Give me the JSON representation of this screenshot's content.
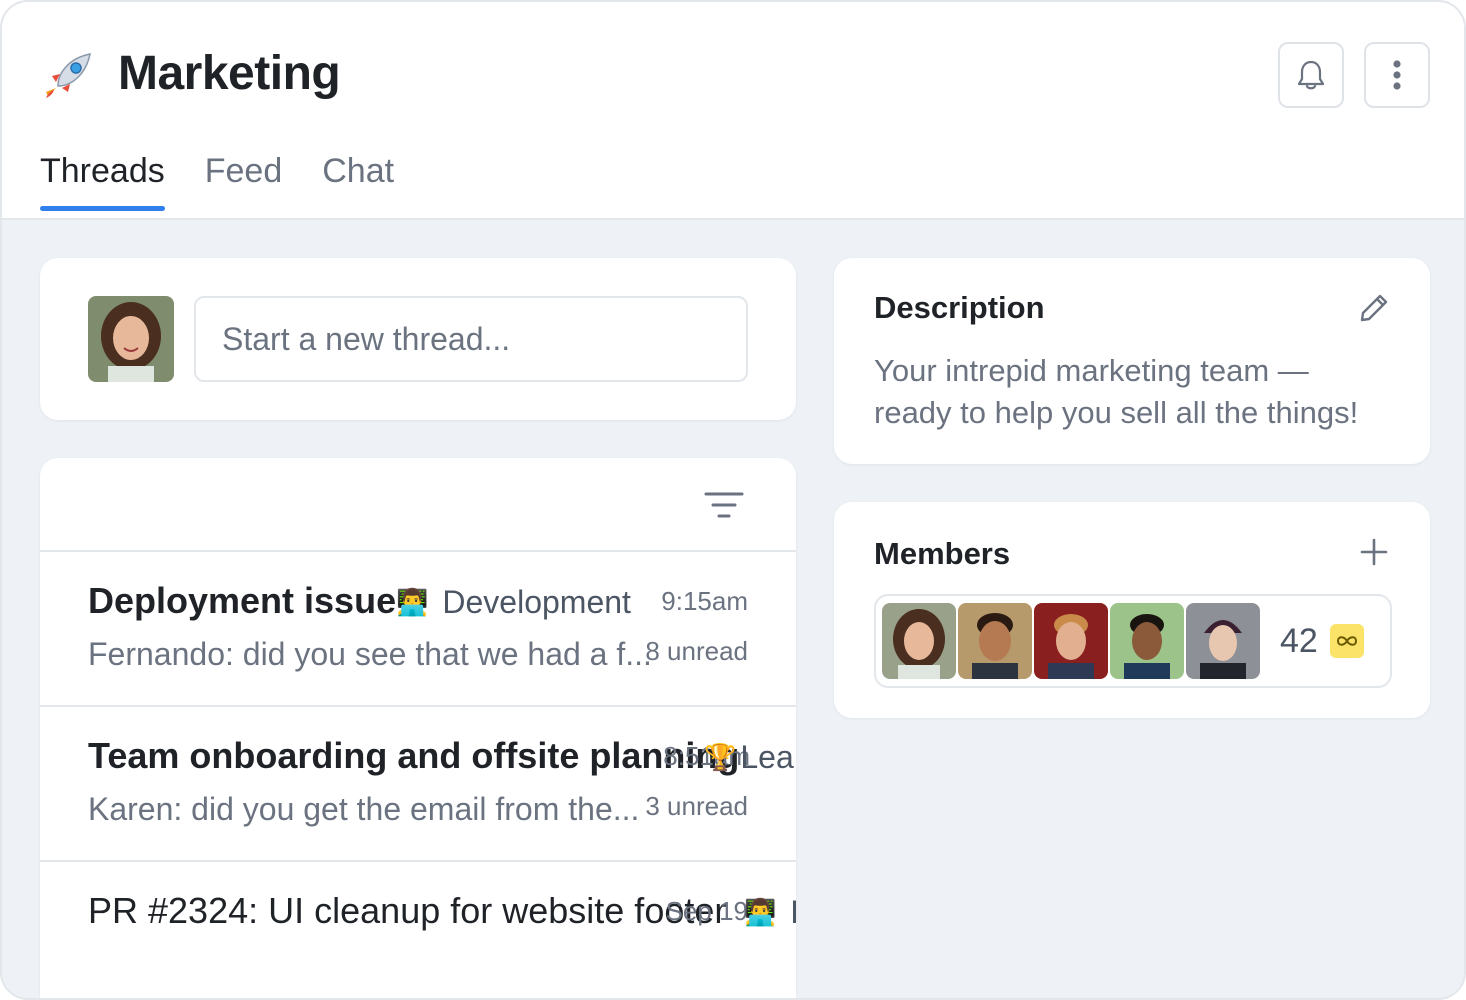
{
  "header": {
    "title": "Marketing",
    "logo_icon": "rocket-icon",
    "notifications_icon": "bell-icon",
    "more_icon": "more-vertical-icon"
  },
  "tabs": [
    {
      "label": "Threads",
      "active": true
    },
    {
      "label": "Feed",
      "active": false
    },
    {
      "label": "Chat",
      "active": false
    }
  ],
  "composer": {
    "placeholder": "Start a new thread..."
  },
  "threads": [
    {
      "title": "Deployment issue",
      "channel": "Development",
      "channel_icon": "developer-icon",
      "time": "9:15am",
      "preview": "Fernando: did you see that we had a f...",
      "unread": "8 unread"
    },
    {
      "title": "Team onboarding and offsite planning",
      "channel": "Lea",
      "channel_icon": "trophy-icon",
      "time": "8:51am",
      "preview": "Karen: did you get the email from the...",
      "unread": "3 unread"
    },
    {
      "title": "PR #2324: UI cleanup for website footer",
      "channel": "D",
      "channel_icon": "developer-icon",
      "time": "Sep 19",
      "preview": "",
      "unread": ""
    }
  ],
  "description": {
    "heading": "Description",
    "text": "Your intrepid marketing team — ready to help you sell all the things!"
  },
  "members": {
    "heading": "Members",
    "count": "42",
    "badge_icon": "infinity-badge-icon"
  },
  "colors": {
    "accent": "#2f80ed",
    "background": "#eef2f6",
    "badge": "#fbe36a"
  }
}
